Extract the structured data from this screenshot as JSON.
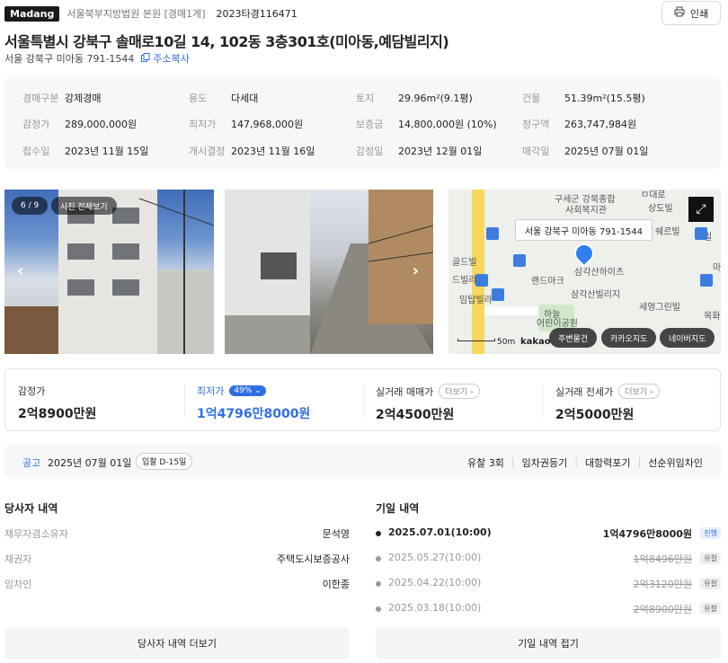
{
  "header": {
    "brand": "Madang",
    "court": "서울북부지방법원 본원 [경매1계]",
    "case_no": "2023타경116471",
    "print_label": "인쇄",
    "title": "서울특별시 강북구 솔매로10길 14, 102동 3층301호(미아동,예담빌리지)",
    "old_address": "서울 강북구 미아동 791-1544",
    "copy_label": "주소복사"
  },
  "info": {
    "cells": [
      {
        "k": "경매구분",
        "v": "강제경매"
      },
      {
        "k": "용도",
        "v": "다세대"
      },
      {
        "k": "토지",
        "v": "29.96m²(9.1평)"
      },
      {
        "k": "건물",
        "v": "51.39m²(15.5평)"
      },
      {
        "k": "감정가",
        "v": "289,000,000원"
      },
      {
        "k": "최저가",
        "v": "147,968,000원"
      },
      {
        "k": "보증금",
        "v": "14,800,000원 (10%)"
      },
      {
        "k": "청구액",
        "v": "263,747,984원"
      },
      {
        "k": "접수일",
        "v": "2023년 11월 15일"
      },
      {
        "k": "개시결정",
        "v": "2023년 11월 16일"
      },
      {
        "k": "감정일",
        "v": "2023년 12월 01일"
      },
      {
        "k": "매각일",
        "v": "2025년 07월 01일"
      }
    ]
  },
  "photos": {
    "counter": "6 / 9",
    "view_all": "사진 전체보기"
  },
  "map": {
    "tooltip": "서울 강북구 미아동 791-1544",
    "labels": [
      "구세군 강북종합",
      "사회복지관",
      "삼각산하이츠",
      "랜드마크",
      "삼각산빌리지",
      "세영그린빌",
      "하늘",
      "어린이공원",
      "임탑빌라",
      "골드빌",
      "드빌라",
      "상도빌",
      "쉐르빌",
      "목화",
      "마",
      "빌",
      "ㅁ대로"
    ],
    "scale": "50m",
    "logo": "kakao",
    "buttons": [
      "주변물건",
      "카카오지도",
      "네이버지도"
    ]
  },
  "prices": [
    {
      "label": "감정가",
      "amount": "2억8900만원"
    },
    {
      "label": "최저가",
      "badge": "49%",
      "amount": "1억4796만8000원"
    },
    {
      "label": "실거래 매매가",
      "more": "더보기",
      "amount": "2억4500만원"
    },
    {
      "label": "실거래 전세가",
      "more": "더보기",
      "amount": "2억5000만원"
    }
  ],
  "notice": {
    "label": "공고",
    "date": "2025년 07월 01일",
    "dday": "입찰 D-15일",
    "tags": [
      "유찰 3회",
      "임차권등기",
      "대항력포기",
      "선순위임차인"
    ]
  },
  "parties": {
    "heading": "당사자 내역",
    "rows": [
      {
        "k": "채무자겸소유자",
        "v": "문석영"
      },
      {
        "k": "채권자",
        "v": "주택도시보증공사"
      },
      {
        "k": "임차인",
        "v": "이한종"
      }
    ],
    "more_button": "당사자 내역 더보기"
  },
  "bids": {
    "heading": "기일 내역",
    "rows": [
      {
        "date": "2025.07.01(10:00)",
        "amount": "1억4796만8000원",
        "status": "진행"
      },
      {
        "date": "2025.05.27(10:00)",
        "amount": "1억8496만원",
        "status": "유찰"
      },
      {
        "date": "2025.04.22(10:00)",
        "amount": "2억3120만원",
        "status": "유찰"
      },
      {
        "date": "2025.03.18(10:00)",
        "amount": "2억8900만원",
        "status": "유찰"
      }
    ],
    "fold_button": "기일 내역 접기"
  }
}
